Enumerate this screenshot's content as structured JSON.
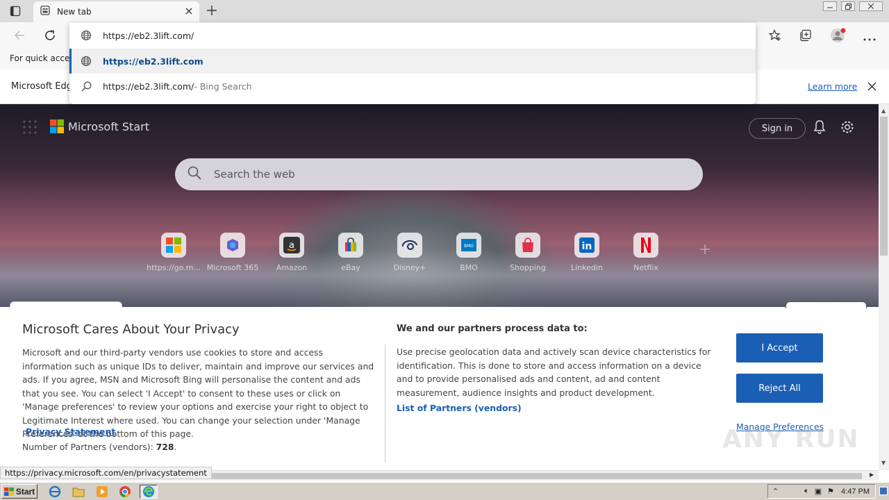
{
  "tab": {
    "title": "New tab"
  },
  "omnibox": {
    "value": "https://eb2.3lift.com/",
    "suggestion_url": "https://eb2.3lift.com",
    "suggestion_search": "https://eb2.3lift.com/",
    "suggestion_search_suffix": " - Bing Search"
  },
  "favbar": {
    "text": "For quick access"
  },
  "infobar": {
    "text": "Microsoft Edg",
    "learn_more": "Learn more"
  },
  "msstart": {
    "brand": "Microsoft Start",
    "sign_in": "Sign in",
    "search_placeholder": "Search the web",
    "tiles": [
      {
        "label": "https://go.m...",
        "icon": "windows-logo-icon"
      },
      {
        "label": "Microsoft 365",
        "icon": "m365-icon"
      },
      {
        "label": "Amazon",
        "icon": "amazon-icon"
      },
      {
        "label": "eBay",
        "icon": "ebay-icon"
      },
      {
        "label": "Disney+",
        "icon": "disney-icon"
      },
      {
        "label": "BMO",
        "icon": "bmo-icon"
      },
      {
        "label": "Shopping",
        "icon": "shopping-icon"
      },
      {
        "label": "Linkedin",
        "icon": "linkedin-icon"
      },
      {
        "label": "Netflix",
        "icon": "netflix-icon"
      }
    ]
  },
  "privacy": {
    "title": "Microsoft Cares About Your Privacy",
    "body": "Microsoft and our third-party vendors use cookies to store and access information such as unique IDs to deliver, maintain and improve our services and ads. If you agree, MSN and Microsoft Bing will personalise the content and ads that you see. You can select 'I Accept' to consent to these uses or click on 'Manage preferences' to review your options and exercise your right to object to Legitimate Interest where used.  You can change your selection under 'Manage Preferences' at the bottom of this page.",
    "privacy_statement": "Privacy Statement",
    "partners_label": "Number of Partners (vendors): ",
    "partners_count": "728",
    "process_title": "We and our partners process data to:",
    "process_body": "Use precise geolocation data and actively scan device characteristics for identification. This is done to store and access information on a device and to provide personalised ads and content, ad and content measurement, audience insights and product development.",
    "list_partners": "List of Partners (vendors)",
    "accept": "I Accept",
    "reject": "Reject All",
    "manage": "Manage Preferences"
  },
  "status_url": "https://privacy.microsoft.com/en/privacystatement",
  "taskbar": {
    "start": "Start",
    "clock": "4:47 PM"
  },
  "watermark": "ANY RUN"
}
